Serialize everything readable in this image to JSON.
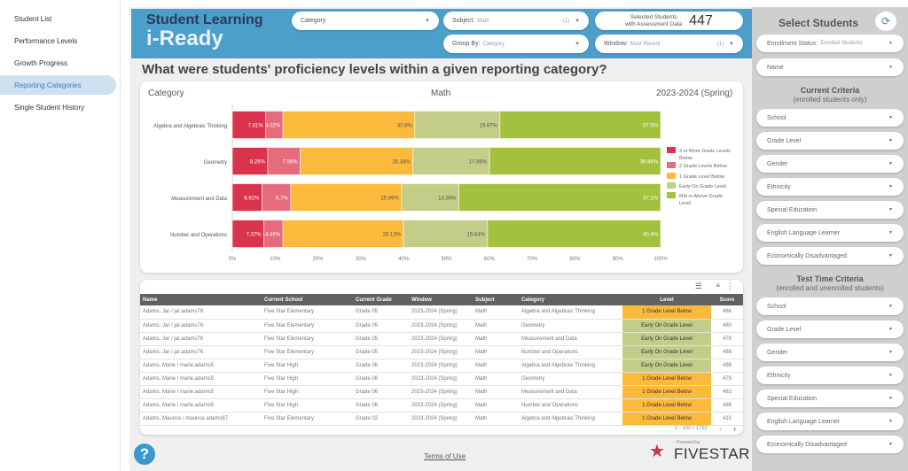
{
  "sidebar": {
    "items": [
      {
        "label": "Student List"
      },
      {
        "label": "Performance Levels"
      },
      {
        "label": "Growth Progress"
      },
      {
        "label": "Reporting Categories",
        "active": true
      },
      {
        "label": "Single Student History"
      }
    ]
  },
  "header": {
    "logo_line1": "Student Learning",
    "logo_line2": "i-Ready",
    "category_filter": {
      "label": "Category"
    },
    "subject_filter": {
      "label": "Subject:",
      "value": "Math",
      "count": "(1)"
    },
    "group_by_filter": {
      "label": "Group By:",
      "value": "Category"
    },
    "window_filter": {
      "label": "Window:",
      "value": "Most Recent",
      "count": "(1)"
    },
    "selected_students": {
      "label_line1": "Selected Students",
      "label_line2": "with Assessment Data",
      "value": "447"
    }
  },
  "question": "What were students' proficiency levels within a given reporting category?",
  "chart_data": {
    "type": "bar",
    "orientation": "horizontal",
    "stacked": true,
    "header_left": "Category",
    "header_center": "Math",
    "header_right": "2023-2024 (Spring)",
    "categories": [
      "Algebra and Algebraic Thinking",
      "Geometry",
      "Measurement and Data",
      "Number and Operations"
    ],
    "series": [
      {
        "name": "3 or More Grade Levels Below",
        "color": "#d9344c",
        "values": [
          7.81,
          8.26,
          6.92,
          7.37
        ],
        "labels": [
          "7.81%",
          "8.26%",
          "6.92%",
          "7.37%"
        ]
      },
      {
        "name": "2 Grade Levels Below",
        "color": "#e56b7d",
        "values": [
          4.02,
          7.59,
          6.7,
          4.46
        ],
        "labels": [
          "4.02%",
          "7.59%",
          "6.7%",
          "4.46%"
        ]
      },
      {
        "name": "1 Grade Level Below",
        "color": "#fbba3c",
        "values": [
          30.8,
          26.34,
          25.89,
          28.13
        ],
        "labels": [
          "30.8%",
          "26.34%",
          "25.89%",
          "28.13%"
        ]
      },
      {
        "name": "Early On Grade Level",
        "color": "#c3cd87",
        "values": [
          19.87,
          17.86,
          13.39,
          19.64
        ],
        "labels": [
          "19.87%",
          "17.86%",
          "13.39%",
          "19.64%"
        ]
      },
      {
        "name": "Mid or Above Grade Level",
        "color": "#a3c13d",
        "values": [
          37.5,
          39.96,
          47.1,
          40.4
        ],
        "labels": [
          "37.5%",
          "39.96%",
          "47.1%",
          "40.4%"
        ]
      }
    ],
    "xlim": [
      0,
      100
    ],
    "xticks": [
      "0%",
      "10%",
      "20%",
      "30%",
      "40%",
      "50%",
      "60%",
      "70%",
      "80%",
      "90%",
      "100%"
    ],
    "legend": "right",
    "grid": false
  },
  "table": {
    "columns": [
      "Name",
      "Current School",
      "Current Grade",
      "Window",
      "Subject",
      "Category",
      "Level",
      "Score"
    ],
    "rows": [
      [
        "Adams, Jar / jar.adams76",
        "Five Star Elementary",
        "Grade 05",
        "2023-2024 (Spring)",
        "Math",
        "Algebra and Algebraic Thinking",
        "1 Grade Level Below",
        "466"
      ],
      [
        "Adams, Jar / jar.adams76",
        "Five Star Elementary",
        "Grade 05",
        "2023-2024 (Spring)",
        "Math",
        "Geometry",
        "Early On Grade Level",
        "480"
      ],
      [
        "Adams, Jar / jar.adams76",
        "Five Star Elementary",
        "Grade 05",
        "2023-2024 (Spring)",
        "Math",
        "Measurement and Data",
        "Early On Grade Level",
        "479"
      ],
      [
        "Adams, Jar / jar.adams76",
        "Five Star Elementary",
        "Grade 05",
        "2023-2024 (Spring)",
        "Math",
        "Number and Operations",
        "Early On Grade Level",
        "488"
      ],
      [
        "Adams, Marie / marie.adams5",
        "Five Star High",
        "Grade 06",
        "2023-2024 (Spring)",
        "Math",
        "Algebra and Algebraic Thinking",
        "Early On Grade Level",
        "498"
      ],
      [
        "Adams, Marie / marie.adams5",
        "Five Star High",
        "Grade 06",
        "2023-2024 (Spring)",
        "Math",
        "Geometry",
        "1 Grade Level Below",
        "479"
      ],
      [
        "Adams, Marie / marie.adams5",
        "Five Star High",
        "Grade 06",
        "2023-2024 (Spring)",
        "Math",
        "Measurement and Data",
        "1 Grade Level Below",
        "462"
      ],
      [
        "Adams, Marie / marie.adams5",
        "Five Star High",
        "Grade 06",
        "2023-2024 (Spring)",
        "Math",
        "Number and Operations",
        "1 Grade Level Below",
        "486"
      ],
      [
        "Adams, Maurice / maurice.adams87",
        "Five Star Elementary",
        "Grade 02",
        "2023-2024 (Spring)",
        "Math",
        "Algebra and Algebraic Thinking",
        "1 Grade Level Below",
        "410"
      ]
    ],
    "level_colors": {
      "1 Grade Level Below": "#fbba3c",
      "Early On Grade Level": "#c3cd87"
    },
    "pagination": "1 - 100 / 1792"
  },
  "footer": {
    "terms": "Terms of Use",
    "powered_by": "Powered by",
    "brand": "FIVESTAR"
  },
  "right_panel": {
    "title": "Select Students",
    "enrollment": {
      "label": "Enrollment Status:",
      "value": "Enrolled Students"
    },
    "name": "Name",
    "current_title": "Current Criteria",
    "current_sub": "(enrolled students only)",
    "current_filters": [
      "School",
      "Grade Level",
      "Gender",
      "Ethnicity",
      "Special Education",
      "English Language Learner",
      "Economically Disadvantaged"
    ],
    "test_title": "Test Time Criteria",
    "test_sub": "(enrolled and unenrolled students)",
    "test_filters": [
      "School",
      "Grade Level",
      "Gender",
      "Ethnicity",
      "Special Education",
      "English Language Learner",
      "Economically Disadvantaged"
    ]
  }
}
